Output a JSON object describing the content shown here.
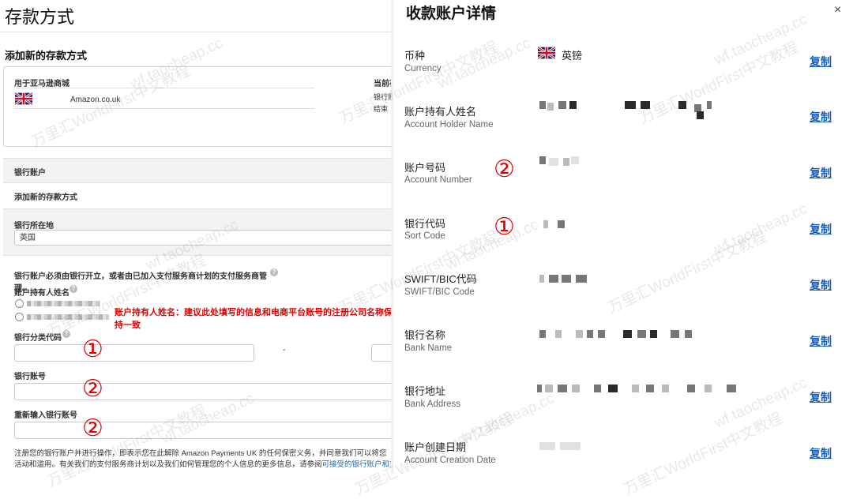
{
  "left": {
    "title": "存款方式",
    "subtitle": "添加新的存款方式",
    "store_label": "用于亚马逊商城",
    "store_name": "Amazon.co.uk",
    "current_label": "当前存",
    "bank_label_cut": "银行账",
    "end_label_cut": "结束",
    "section_bank_account": "银行账户",
    "add_new_method": "添加新的存款方式",
    "bank_location_label": "银行所在地",
    "bank_location_value": "英国",
    "notice": "银行账户必须由银行开立，或者由已加入支付服务商计划的支付服务商管理。",
    "holder_label": "账户持有人姓名",
    "holder_tip": "账户持有人姓名：建议此处填写的信息和电商平台账号的注册公司名称保持一致",
    "sort_code_label": "银行分类代码",
    "sort_code_dash": "-",
    "account_number_label": "银行账号",
    "reenter_label": "重新输入银行账号",
    "marker_1": "①",
    "marker_2": "②",
    "marker_3": "②",
    "footer_line1": "注册您的银行账户并进行操作，即表示您在此解除 Amazon Payments UK 的任何保密义务，并同意我们可以将您",
    "footer_line2": "活动和滥用。有关我们的支付服务商计划以及我们如何管理您的个人信息的更多信息，请参阅",
    "footer_link": "可接受的银行账户和支"
  },
  "right": {
    "title": "收款账户详情",
    "close_icon": "×",
    "copy_label": "复制",
    "rows": [
      {
        "zh": "币种",
        "en": "Currency",
        "value": "英镑"
      },
      {
        "zh": "账户持有人姓名",
        "en": "Account Holder Name"
      },
      {
        "zh": "账户号码",
        "en": "Account Number",
        "marker": "②"
      },
      {
        "zh": "银行代码",
        "en": "Sort Code",
        "marker": "①"
      },
      {
        "zh": "SWIFT/BIC代码",
        "en": "SWIFT/BIC Code"
      },
      {
        "zh": "银行名称",
        "en": "Bank Name"
      },
      {
        "zh": "银行地址",
        "en": "Bank Address"
      },
      {
        "zh": "账户创建日期",
        "en": "Account Creation Date"
      }
    ]
  },
  "watermark": {
    "cn": "万里汇WorldFirst中文教程",
    "url": "wf.taocheap.cc"
  },
  "colors": {
    "accent": "#1b5fb5",
    "annotation": "#e00000"
  }
}
